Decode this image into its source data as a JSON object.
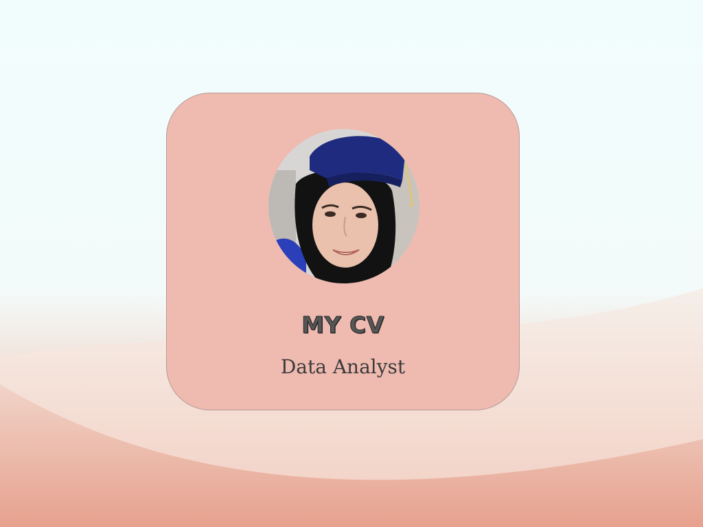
{
  "card": {
    "title": "MY CV",
    "subtitle": "Data Analyst"
  },
  "profile_photo": {
    "alt": "Profile photo",
    "icon": "person-with-graduation-cap"
  },
  "colors": {
    "card_background": "#efbab0",
    "page_top": "#f1fdfd",
    "page_bottom": "#e49a86",
    "title_text": "#565656",
    "subtitle_text": "#3a3a3a"
  }
}
